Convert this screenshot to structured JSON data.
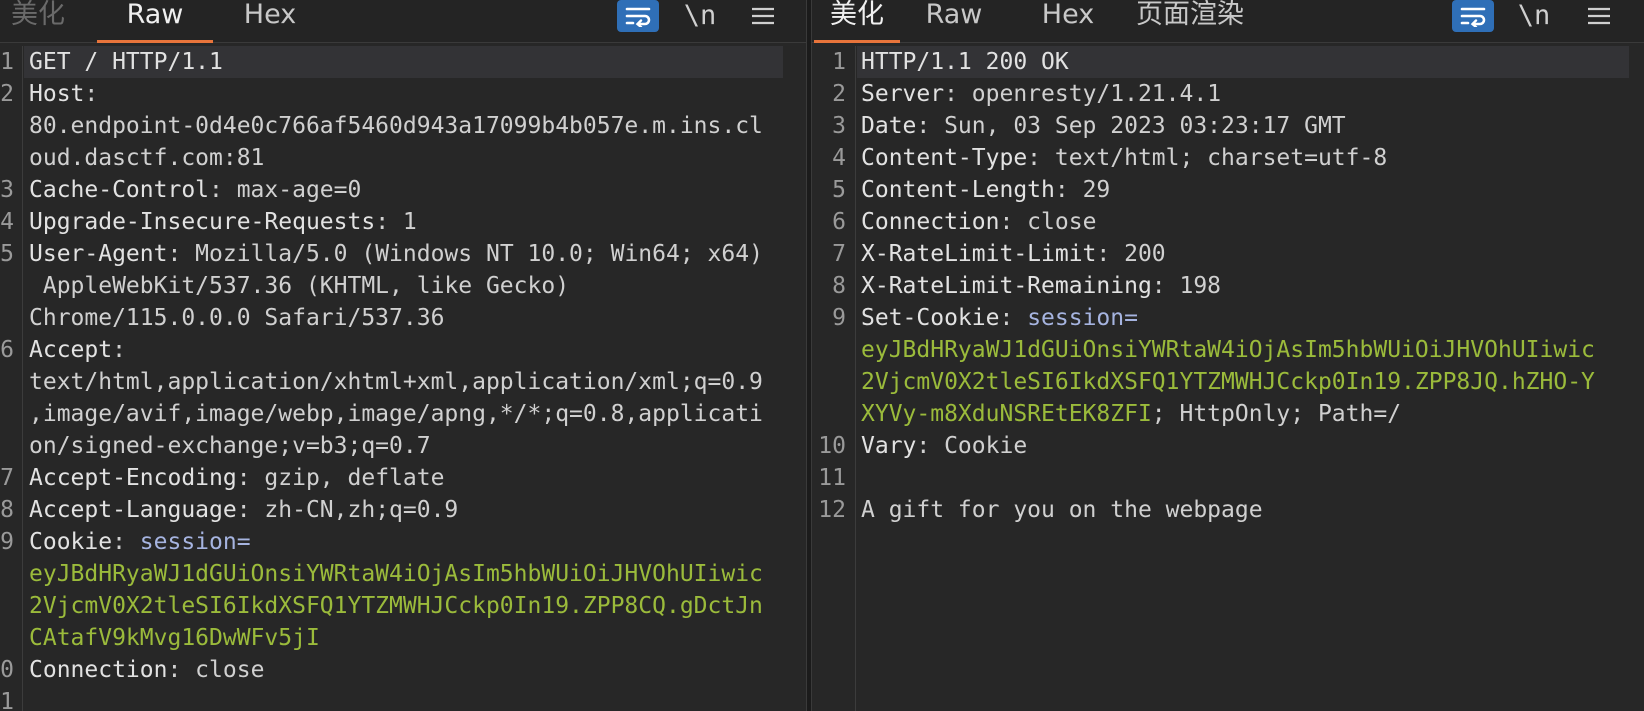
{
  "request": {
    "tabs": [
      {
        "label": "美化"
      },
      {
        "label": "Raw"
      },
      {
        "label": "Hex"
      }
    ],
    "newline_label": "\\n",
    "line_numbers": [
      "1",
      "2",
      "3",
      "4",
      "5",
      "6",
      "7",
      "8",
      "9",
      "0",
      "1"
    ],
    "lines": {
      "l1": "GET / HTTP/1.1",
      "l2_key": "Host",
      "l2_sep": ":",
      "l2_c1": "80.endpoint-0d4e0c766af5460d943a17099b4b057e.m.ins.cl",
      "l2_c2": "oud.dasctf.com:81",
      "l3_key": "Cache-Control",
      "l3_val": ": max-age=0",
      "l4_key": "Upgrade-Insecure-Requests",
      "l4_val": ": 1",
      "l5_key": "User-Agent",
      "l5_val": ": Mozilla/5.0 (Windows NT 10.0; Win64; x64)",
      "l5_c1": " AppleWebKit/537.36 (KHTML, like Gecko)",
      "l5_c2": "Chrome/115.0.0.0 Safari/537.36",
      "l6_key": "Accept",
      "l6_sep": ":",
      "l6_c1": "text/html,application/xhtml+xml,application/xml;q=0.9",
      "l6_c2": ",image/avif,image/webp,image/apng,*/*;q=0.8,applicati",
      "l6_c3": "on/signed-exchange;v=b3;q=0.7",
      "l7_key": "Accept-Encoding",
      "l7_val": ": gzip, deflate",
      "l8_key": "Accept-Language",
      "l8_val": ": zh-CN,zh;q=0.9",
      "l9_key": "Cookie",
      "l9_sep": ": ",
      "l9_name": "session=",
      "l9_c1": "eyJBdHRyaWJ1dGUiOnsiYWRtaW4iOjAsIm5hbWUiOiJHVOhUIiwic",
      "l9_c2": "2VjcmV0X2tleSI6IkdXSFQ1YTZMWHJCckp0In19.ZPP8CQ.gDctJn",
      "l9_c3": "CAtafV9kMvg16DwWFv5jI",
      "l10_key": "Connection",
      "l10_val": ": close"
    }
  },
  "response": {
    "tabs": [
      {
        "label": "美化"
      },
      {
        "label": "Raw"
      },
      {
        "label": "Hex"
      },
      {
        "label": "页面渲染"
      }
    ],
    "newline_label": "\\n",
    "line_numbers": [
      "1",
      "2",
      "3",
      "4",
      "5",
      "6",
      "7",
      "8",
      "9",
      "10",
      "11",
      "12"
    ],
    "lines": {
      "l1": "HTTP/1.1 200 OK",
      "l2_key": "Server",
      "l2_val": ": openresty/1.21.4.1",
      "l3_key": "Date",
      "l3_val": ": Sun, 03 Sep 2023 03:23:17 GMT",
      "l4_key": "Content-Type",
      "l4_val": ": text/html; charset=utf-8",
      "l5_key": "Content-Length",
      "l5_val": ": 29",
      "l6_key": "Connection",
      "l6_val": ": close",
      "l7_key": "X-RateLimit-Limit",
      "l7_val": ": 200",
      "l8_key": "X-RateLimit-Remaining",
      "l8_val": ": 198",
      "l9_key": "Set-Cookie",
      "l9_sep": ": ",
      "l9_name": "session=",
      "l9_c1": "eyJBdHRyaWJ1dGUiOnsiYWRtaW4iOjAsIm5hbWUiOiJHVOhUIiwic",
      "l9_c2": "2VjcmV0X2tleSI6IkdXSFQ1YTZMWHJCckp0In19.ZPP8JQ.hZHO-Y",
      "l9_c3": "XYVy-m8XduNSREtEK8ZFI",
      "l9_c3_tail": "; HttpOnly; Path=/",
      "l10_key": "Vary",
      "l10_val": ": Cookie",
      "l12": "A gift for you on the webpage"
    }
  },
  "colors": {
    "accent_tab": "#e8743b",
    "button_blue": "#2f6fb7",
    "cookie_value": "#9bbb3b",
    "cookie_name": "#a6b4e0"
  }
}
